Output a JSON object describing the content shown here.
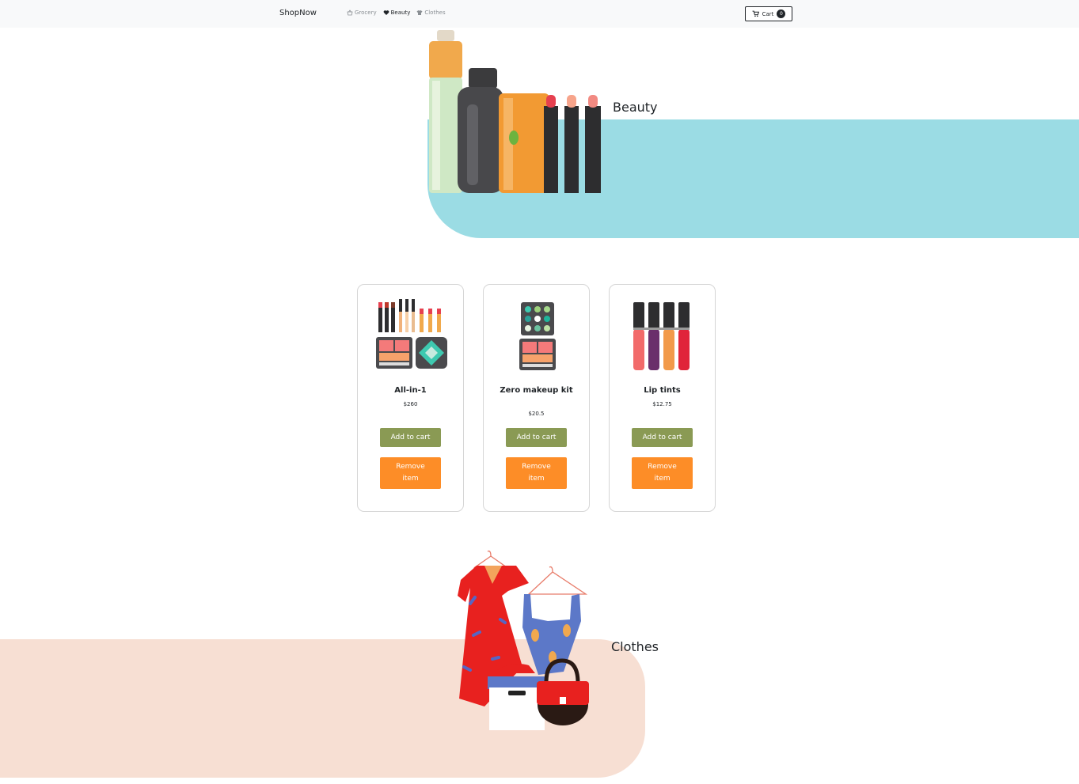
{
  "navbar": {
    "brand": "ShopNow",
    "links": [
      {
        "label": "Grocery",
        "icon": "basket-icon",
        "active": false
      },
      {
        "label": "Beauty",
        "icon": "heart-icon",
        "active": true
      },
      {
        "label": "Clothes",
        "icon": "shirt-icon",
        "active": false
      }
    ],
    "cart": {
      "label": "Cart",
      "count": "0",
      "icon": "cart-icon"
    }
  },
  "sections": {
    "beauty": {
      "title": "Beauty",
      "band_color": "#9bdce4"
    },
    "clothes": {
      "title": "Clothes",
      "band_color": "#f7dfd3"
    }
  },
  "products": [
    {
      "name": "All-in-1",
      "price": "$260",
      "add_label": "Add to cart",
      "remove_label": "Remove item",
      "image": "makeup-set-image"
    },
    {
      "name": "Zero makeup kit",
      "price": "$20.5",
      "add_label": "Add to cart",
      "remove_label": "Remove item",
      "image": "palette-kit-image"
    },
    {
      "name": "Lip tints",
      "price": "$12.75",
      "add_label": "Add to cart",
      "remove_label": "Remove item",
      "image": "lip-tints-image"
    }
  ],
  "colors": {
    "add_button": "#8a9a54",
    "remove_button": "#fd8d27"
  }
}
